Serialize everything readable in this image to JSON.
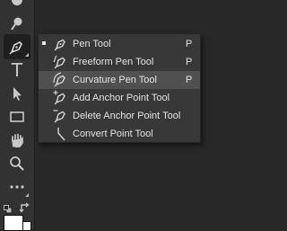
{
  "toolbar": {
    "tools": [
      {
        "icon": "spot-healing-brush-icon"
      },
      {
        "icon": "burn-tool-icon"
      },
      {
        "icon": "pen-tool-icon",
        "active": true
      },
      {
        "icon": "type-tool-icon",
        "label": "T"
      },
      {
        "icon": "path-selection-arrow-icon"
      },
      {
        "icon": "rectangle-tool-icon"
      },
      {
        "icon": "hand-tool-icon"
      },
      {
        "icon": "zoom-tool-icon"
      },
      {
        "icon": "more-tools-ellipsis-icon"
      }
    ],
    "colors": {
      "foreground": "#ffffff",
      "background": "#ffffff"
    }
  },
  "flyout": {
    "items": [
      {
        "label": "Pen Tool",
        "shortcut": "P",
        "icon": "pen-tool-icon",
        "selected": true
      },
      {
        "label": "Freeform Pen Tool",
        "shortcut": "P",
        "icon": "freeform-pen-icon"
      },
      {
        "label": "Curvature Pen Tool",
        "shortcut": "P",
        "icon": "curvature-pen-icon",
        "hovered": true
      },
      {
        "label": "Add Anchor Point Tool",
        "shortcut": "",
        "icon": "add-anchor-point-icon"
      },
      {
        "label": "Delete Anchor Point Tool",
        "shortcut": "",
        "icon": "delete-anchor-point-icon"
      },
      {
        "label": "Convert Point Tool",
        "shortcut": "",
        "icon": "convert-point-icon"
      }
    ]
  }
}
